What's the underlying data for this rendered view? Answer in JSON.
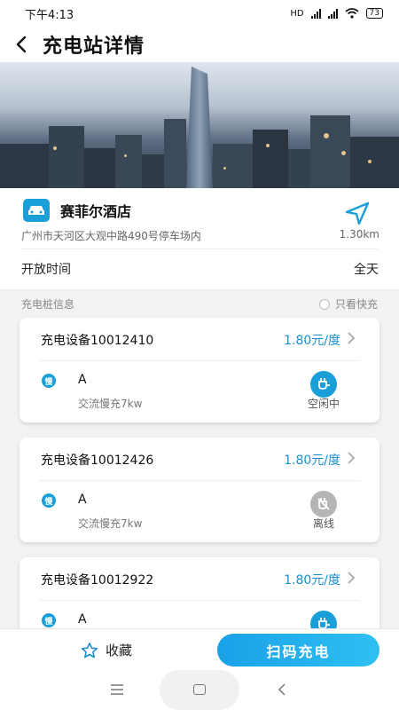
{
  "status_bar": {
    "time": "下午4:13",
    "network": "HD",
    "battery": "73"
  },
  "header": {
    "title": "充电站详情"
  },
  "station": {
    "name": "赛菲尔酒店",
    "address": "广州市天河区大观中路490号停车场内",
    "distance": "1.30km",
    "hours_label": "开放时间",
    "hours_value": "全天"
  },
  "section": {
    "title": "充电桩信息",
    "fast_filter_label": "只看快充"
  },
  "devices": [
    {
      "name": "充电设备10012410",
      "price": "1.80元/度",
      "badge": "慢",
      "port": "A",
      "type": "交流慢充7kw",
      "status": "空闲中"
    },
    {
      "name": "充电设备10012426",
      "price": "1.80元/度",
      "badge": "慢",
      "port": "A",
      "type": "交流慢充7kw",
      "status": "离线"
    },
    {
      "name": "充电设备10012922",
      "price": "1.80元/度",
      "badge": "慢",
      "port": "A"
    }
  ],
  "actions": {
    "favorite_label": "收藏",
    "scan_label": "扫码充电"
  },
  "colors": {
    "accent": "#1a9fd8",
    "price": "#1a8fd0",
    "offline": "#b5b5b5"
  }
}
